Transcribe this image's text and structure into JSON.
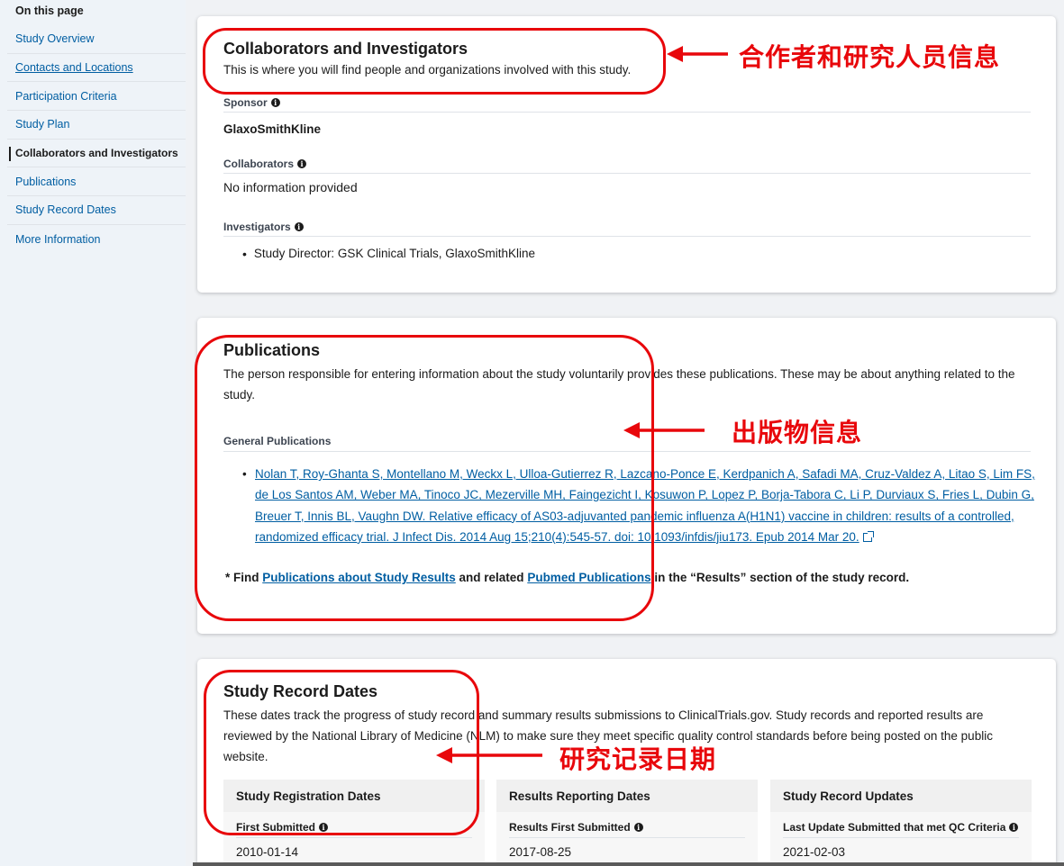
{
  "sidebar": {
    "title": "On this page",
    "items": [
      {
        "label": "Study Overview"
      },
      {
        "label": "Contacts and Locations"
      },
      {
        "label": "Participation Criteria"
      },
      {
        "label": "Study Plan"
      },
      {
        "label": "Collaborators and Investigators"
      },
      {
        "label": "Publications"
      },
      {
        "label": "Study Record Dates"
      },
      {
        "label": "More Information"
      }
    ],
    "active": "Collaborators and Investigators"
  },
  "collaborators": {
    "title": "Collaborators and Investigators",
    "description": "This is where you will find people and organizations involved with this study.",
    "sponsor_label": "Sponsor",
    "sponsor_value": "GlaxoSmithKline",
    "collaborators_label": "Collaborators",
    "collaborators_value": "No information provided",
    "investigators_label": "Investigators",
    "investigators": [
      "Study Director: GSK Clinical Trials,  GlaxoSmithKline"
    ]
  },
  "publications": {
    "title": "Publications",
    "description": "The person responsible for entering information about the study voluntarily provides these publications. These may be about anything related to the study.",
    "general_label": "General Publications",
    "items": [
      "Nolan T, Roy-Ghanta S, Montellano M, Weckx L, Ulloa-Gutierrez R, Lazcano-Ponce E, Kerdpanich A, Safadi MA, Cruz-Valdez A, Litao S, Lim FS, de Los Santos AM, Weber MA, Tinoco JC, Mezerville MH, Faingezicht I, Kosuwon P, Lopez P, Borja-Tabora C, Li P, Durviaux S, Fries L, Dubin G, Breuer T, Innis BL, Vaughn DW. Relative efficacy of AS03-adjuvanted pandemic influenza A(H1N1) vaccine in children: results of a controlled, randomized efficacy trial. J Infect Dis. 2014 Aug 15;210(4):545-57. doi: 10.1093/infdis/jiu173. Epub 2014 Mar 20."
    ],
    "find_prefix": "* Find ",
    "find_link1": "Publications about Study Results",
    "find_middle": " and related ",
    "find_link2": "Pubmed Publications",
    "find_suffix": " in the “Results” section of the study record."
  },
  "record_dates": {
    "title": "Study Record Dates",
    "description": "These dates track the progress of study record and summary results submissions to ClinicalTrials.gov. Study records and reported results are reviewed by the National Library of Medicine (NLM) to make sure they meet specific quality control standards before being posted on the public website.",
    "columns": [
      {
        "header": "Study Registration Dates",
        "field": "First Submitted",
        "value": "2010-01-14"
      },
      {
        "header": "Results Reporting Dates",
        "field": "Results First Submitted",
        "value": "2017-08-25"
      },
      {
        "header": "Study Record Updates",
        "field": "Last Update Submitted that met QC Criteria",
        "value": "2021-02-03"
      }
    ]
  },
  "annotations": {
    "collab": "合作者和研究人员信息",
    "pubs": "出版物信息",
    "dates": "研究记录日期",
    "color": "#e8070b"
  },
  "colors": {
    "link": "#005ea2",
    "text": "#1b1b1b",
    "page_bg": "#f0f2f5",
    "sidebar_bg": "#eef3f8"
  },
  "icons": {
    "info": "info-circle-icon",
    "external": "external-link-icon"
  }
}
